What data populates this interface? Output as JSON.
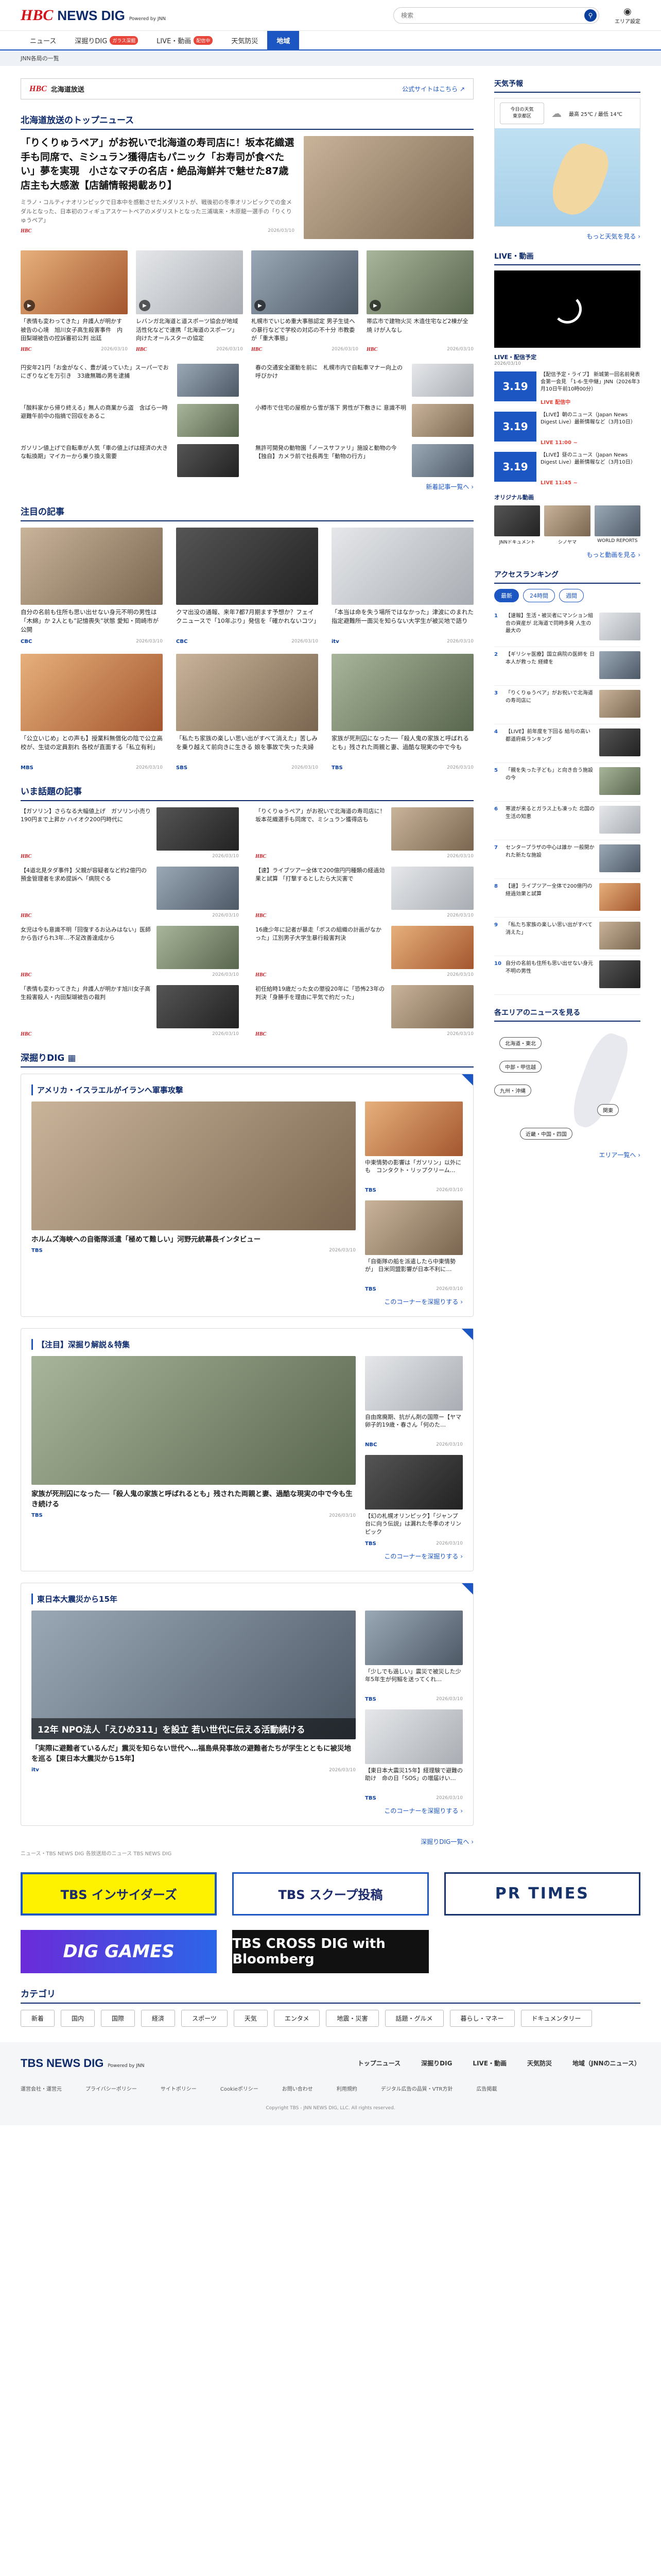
{
  "header": {
    "logo_hbc": "HBC",
    "logo_news": "NEWS DIG",
    "powered": "Powered by JNN",
    "search_placeholder": "検索",
    "area_label": "エリア設定"
  },
  "nav": [
    {
      "label": "ニュース"
    },
    {
      "label": "深掘りDIG",
      "badge": "ガラス深掘"
    },
    {
      "label": "LIVE・動画",
      "badge": "配信中"
    },
    {
      "label": "天気防災"
    },
    {
      "label": "地域",
      "active": true
    }
  ],
  "subnav": "JNN各局の一覧",
  "station": {
    "logo": "HBC",
    "name": "北海道放送",
    "link": "公式サイトはこちら"
  },
  "top_news": {
    "heading": "北海道放送のトップニュース",
    "lead_title": "「りくりゅうペア」がお祝いで北海道の寿司店に！坂本花織選手も同席で、ミシュラン獲得店もパニック「お寿司が食べたい」夢を実現　小さなマチの名店・絶品海鮮丼で魅せた87歳店主も大感激【店舗情報掲載あり】",
    "lead_desc": "ミラノ・コルティナオリンピックで日本中を感動させたメダリストが、戦後初の冬季オリンピックでの金メダルとなった、日本初のフィギュアスケートペアのメダリストとなった三浦璃来・木原龍一選手の「りくりゅうペア」",
    "lead_date": "2026/03/10",
    "grid": [
      {
        "title": "「表情も変わってきた」弁護人が明かす被告の心境　旭川女子高生殺害事件　内田梨瑚被告の控訴審初公判 出廷",
        "date": "2026/03/10"
      },
      {
        "title": "レバンガ北海道と道スポーツ協会が地域活性化などで連携「北海道のスポーツ」向けたオールスターの協定",
        "date": "2026/03/10"
      },
      {
        "title": "札幌市でいじめ重大事態認定 男子生徒への暴行などで学校の対応の不十分 市教委が「重大事態」",
        "date": "2026/03/10"
      },
      {
        "title": "帯広市で建物火災 木造住宅など2棟が全焼 けが人なし",
        "date": "2026/03/10"
      },
      {
        "title": "円安年21円「お金がなく、豊が減っていた」スーパーでおにぎりなどを万引き　33歳無職の男を逮捕",
        "date": "2026/03/10"
      },
      {
        "title": "春の交通安全運動を前に　札幌市内で自転車マナー向上の呼びかけ",
        "date": "2026/03/10"
      },
      {
        "title": "「酸料家から帰り終える」無人の商業から盗　含ばら一時避難午前中の指摘で回収をあるこ",
        "date": "2026/03/10"
      },
      {
        "title": "小樽市で住宅の屋根から雪が落下 男性が下敷きに 意識不明",
        "date": "2026/03/10"
      },
      {
        "title": "ガソリン値上げで自転車が人気「車の値上げは経済の大きな転換期」マイカーから乗り換え需要",
        "date": "2026/03/10"
      },
      {
        "title": "無許可開発の動物園「ノースサファリ」施設と動物の今【独自】カメラ前で社長再生「動物の行方」",
        "date": "2026/03/10"
      }
    ],
    "more": "新着記事一覧へ"
  },
  "featured": {
    "heading": "注目の記事",
    "items": [
      {
        "title": "自分の名前も住所も思い出せない身元不明の男性は「木綿」か 2人とも”記憶喪失”状態 愛知・岡崎市が公開",
        "date": "2026/03/10",
        "src": "CBC"
      },
      {
        "title": "クマ出没の通報、来年7都7月期ます予想か？フェイクニュースで「10年ぶり」発信を「確かれないコツ」",
        "date": "2026/03/10",
        "src": "CBC"
      },
      {
        "title": "「本当は命を失う場所ではなかった」津波にのまれた指定避難所一面災を知らない大学生が被災地で語り",
        "date": "2026/03/10",
        "src": "itv"
      },
      {
        "title": "「公立いじめ」との声も】授業料無償化の陰で公立高校が、生徒の定員割れ 各校が直面する「私立有利」",
        "date": "2026/03/10",
        "src": "MBS"
      },
      {
        "title": "「私たち家族の楽しい思い出がすべて消えた」苦しみを乗り越えて前向きに生きる 娘を事故で失った夫婦",
        "date": "2026/03/10",
        "src": "SBS"
      },
      {
        "title": "家族が死刑囚になった──「殺人鬼の家族と呼ばれるとも」残された両親と妻、過酷な現実の中で今も",
        "date": "2026/03/10",
        "src": "TBS"
      }
    ]
  },
  "hot": {
    "heading": "いま話題の記事",
    "items": [
      {
        "title": "【ガソリン】さらなる大幅値上げ　ガソリン小売り190円まで上昇か ハイオク200円時代に",
        "date": "2026/03/10"
      },
      {
        "title": "「りくりゅうペア」がお祝いで北海道の寿司店に！坂本花織選手も同席で、ミシュラン獲得店も",
        "date": "2026/03/10"
      },
      {
        "title": "【4道北見タダ事件】父親が容疑者など約2億円の預金管理者を求め提訴へ「病院ぐる",
        "date": "2026/03/10"
      },
      {
        "title": "【速】ライブツアー全体で200億円円種類の経過効果と試算 「打撃するとしたら大災害で",
        "date": "2026/03/10"
      },
      {
        "title": "女児は今も意識不明「回復するお込みはない」医師から告げられ3年…不足改善達成から",
        "date": "2026/03/10"
      },
      {
        "title": "16歳少年に記者が暴走「ボスの組織の計画がなかった」江別男子大学生暴行殺害判決",
        "date": "2026/03/10"
      },
      {
        "title": "「表情も変わってきた」弁護人が明かす旭川女子高生殺害殺人・内田梨瑚被告の裁判",
        "date": "2026/03/10"
      },
      {
        "title": "初任給時19歳だった女の懲役20年に「恐怖23年の判決「身勝手を理由に平気で約だった」",
        "date": "2026/03/10"
      }
    ]
  },
  "dig": {
    "heading": "深掘りDIG",
    "blocks": [
      {
        "title": "アメリカ・イスラエルがイランへ軍事攻撃",
        "big": {
          "title": "ホルムズ海峡への自衛隊派遣「極めて難しい」河野元統幕長インタビュー",
          "src": "TBS",
          "date": "2026/03/10"
        },
        "small": [
          {
            "title": "中東情勢の影響は「ガソリン」以外にも　コンタクト・リップクリーム…",
            "src": "TBS",
            "date": "2026/03/10"
          },
          {
            "title": "「自衛隊の船を派遣したら中東情勢が」 日米同盟影響が日本不利に…",
            "src": "TBS",
            "date": "2026/03/10"
          }
        ],
        "more": "このコーナーを深掘りする"
      },
      {
        "title": "【注目】深掘り解説＆特集",
        "big": {
          "title": "家族が死刑囚になった──「殺人鬼の家族と呼ばれるとも」残された両親と妻、過酷な現実の中で今も生き続ける",
          "src": "TBS",
          "date": "2026/03/10"
        },
        "small": [
          {
            "title": "自由席廃期、抗がん剤の国際ー【ヤマ卵子的19歳・春さん「何のた…",
            "src": "NBC",
            "date": "2026/03/10"
          },
          {
            "title": "【幻の札幌オリンピック】「ジャンプ台に向う伝説」は漏れた冬季のオリンピック",
            "src": "TBS",
            "date": "2026/03/10"
          }
        ],
        "more": "このコーナーを深掘りする"
      },
      {
        "title": "東日本大震災から15年",
        "big": {
          "title": "「実際に避難者ているんだ」震災を知らない世代へ…福島県発事故の避難者たちが学生とともに被災地を巡る【東日本大震災から15年】",
          "src": "itv",
          "date": "2026/03/10",
          "caption": "12年 NPO法人「えひめ311」を設立 若い世代に伝える活動続ける"
        },
        "small": [
          {
            "title": "「少しでも過しい」震災で被災した少年5年生が何鰯を送ってくれ…",
            "src": "TBS",
            "date": "2026/03/10"
          },
          {
            "title": "【東日本大震災15年】経理験で避難の助け　命の日「SOS」の増届けい…",
            "src": "TBS",
            "date": "2026/03/10"
          }
        ],
        "more": "このコーナーを深掘りする"
      }
    ],
    "more_all": "深掘りDIG一覧へ",
    "note": "ニュース・TBS NEWS DIG 各放送局のニュース TBS NEWS DIG"
  },
  "banners": [
    "TBS インサイダーズ",
    "TBS スクープ投稿",
    "PR TIMES",
    "DIG GAMES",
    "TBS CROSS DIG with Bloomberg"
  ],
  "categories": {
    "heading": "カテゴリ",
    "items": [
      "新着",
      "国内",
      "国際",
      "経済",
      "スポーツ",
      "天気",
      "エンタメ",
      "地震・災害",
      "話題・グルメ",
      "暮らし・マネー",
      "ドキュメンタリー"
    ]
  },
  "sidebar": {
    "weather": {
      "heading": "天気予報",
      "today": "今日の天気",
      "city": "東京都区",
      "temp": "最高 25℃ / 最低 14℃",
      "more": "もっと天気を見る"
    },
    "live": {
      "heading": "LIVE・動画",
      "sub": "LIVE・配信予定",
      "date": "2026/03/10",
      "items": [
        {
          "date": "3.19",
          "title": "【配信予定・ライブ】 新城第一回名前発表会第一会見 「1-6-生中継」JNN（2026年3月10日午前10時00分）",
          "status": "LIVE 配信中"
        },
        {
          "date": "3.19",
          "title": "【LIVE】朝のニュース（Japan News Digest Live）最新情報など（3月10日）",
          "status": "LIVE 11:00 ~"
        },
        {
          "date": "3.19",
          "title": "【LIVE】昼のニュース（Japan News Digest Live）最新情報など（3月10日）",
          "status": "LIVE 11:45 ~"
        }
      ],
      "original_heading": "オリジナル動画",
      "originals": [
        "JNNドキュメント",
        "シノヤマ",
        "WORLD REPORTS"
      ],
      "more": "もっと動画を見る"
    },
    "ranking": {
      "heading": "アクセスランキング",
      "tabs": [
        "最新",
        "24時間",
        "週間"
      ],
      "items": [
        {
          "title": "【速報】生活・被災者にマンション組合の資産が 北海道で同時多発 人生の最大の"
        },
        {
          "title": "【ギリシャ医療】国立病院の医師を 日本人が救った 経緯を"
        },
        {
          "title": "「りくりゅうペア」がお祝いで北海道の寿司店に"
        },
        {
          "title": "【LIVE】前年度を下回る 給与の高い都道府県ランキング"
        },
        {
          "title": "「親を失った子ども」と向き合う施設の今"
        },
        {
          "title": "寒波が来るとガラス上も凍った 北国の生活の知恵"
        },
        {
          "title": "センタープラザの中心は誰か 一般開かれた新たな施設"
        },
        {
          "title": "【速】ライブツアー全体で200億円の経過効果と試算"
        },
        {
          "title": "「私たち家族の楽しい思い出がすべて消えた」"
        },
        {
          "title": "自分の名前も住所も思い出せない身元不明の男性"
        }
      ]
    },
    "regions": {
      "heading": "各エリアのニュースを見る",
      "items": [
        "北海道・東北",
        "中部・甲信越",
        "九州・沖縄",
        "関東",
        "近畿・中国・四国"
      ],
      "more": "エリア一覧へ"
    }
  },
  "footer": {
    "logo": "TBS NEWS DIG",
    "powered": "Powered by JNN",
    "links": [
      "トップニュース",
      "深掘りDIG",
      "LIVE・動画",
      "天気防災",
      "地域（JNNのニュース）"
    ],
    "links2": [
      "運営会社・運営元",
      "プライバシーポリシー",
      "サイトポリシー",
      "Cookieポリシー",
      "お問い合わせ",
      "利用規約",
      "デジタル広告の品質・VTR方針",
      "広告掲載"
    ],
    "copyright": "Copyright TBS - JNN NEWS DIG, LLC. All rights reserved."
  }
}
